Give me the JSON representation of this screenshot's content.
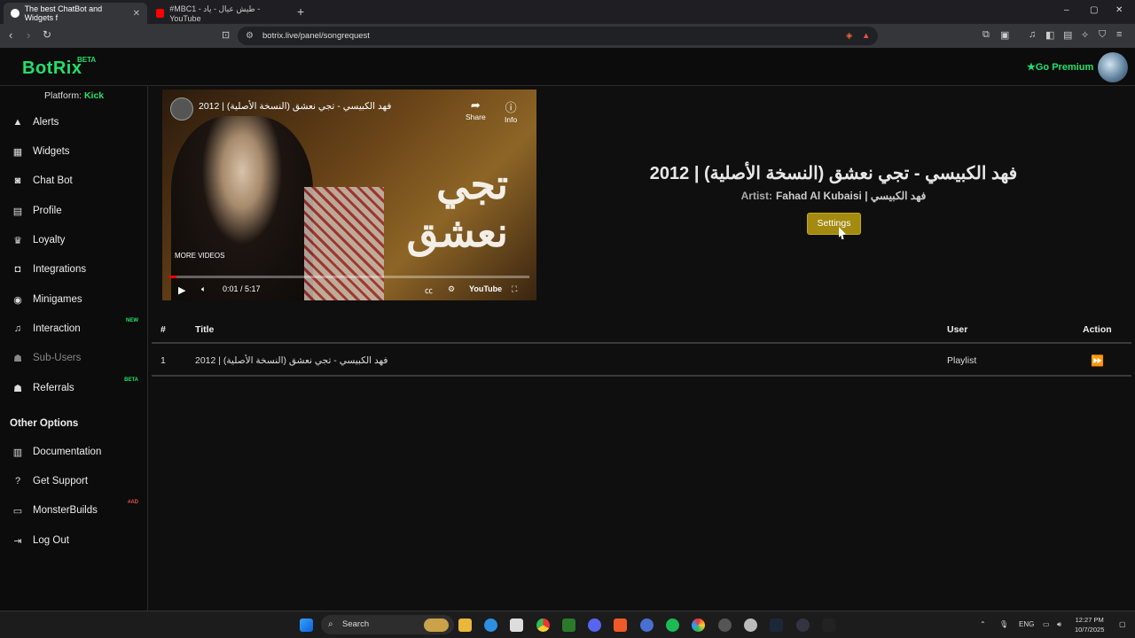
{
  "browser": {
    "tabs": [
      {
        "label": "The best ChatBot and Widgets f",
        "active": true
      },
      {
        "label": "#MBC1 - طيش عيال - ياد - YouTube",
        "active": false
      }
    ],
    "new_tab": "+",
    "window_controls": [
      "–",
      "▢",
      "✕"
    ],
    "url": "botrix.live/panel/songrequest"
  },
  "header": {
    "logo": "BotRix",
    "logo_badge": "BETA",
    "premium_label": "Go Premium"
  },
  "sidebar": {
    "platform_label": "Platform:",
    "platform_value": "Kick",
    "items": [
      {
        "label": "Alerts",
        "icon": "warning-icon"
      },
      {
        "label": "Widgets",
        "icon": "grid-icon"
      },
      {
        "label": "Chat Bot",
        "icon": "robot-icon"
      },
      {
        "label": "Profile",
        "icon": "id-card-icon"
      },
      {
        "label": "Loyalty",
        "icon": "trophy-icon"
      },
      {
        "label": "Integrations",
        "icon": "discord-icon"
      },
      {
        "label": "Minigames",
        "icon": "gamepad-icon"
      },
      {
        "label": "Interaction",
        "icon": "music-icon",
        "tag": "NEW"
      },
      {
        "label": "Sub-Users",
        "icon": "users-icon",
        "muted": true
      },
      {
        "label": "Referrals",
        "icon": "users-icon",
        "tag": "BETA"
      }
    ],
    "other_title": "Other Options",
    "other_items": [
      {
        "label": "Documentation",
        "icon": "book-icon"
      },
      {
        "label": "Get Support",
        "icon": "question-icon"
      },
      {
        "label": "MonsterBuilds",
        "icon": "laptop-icon",
        "tag": "#AD"
      },
      {
        "label": "Log Out",
        "icon": "logout-icon"
      }
    ]
  },
  "player": {
    "video_title": "فهد الكبيسي - تجي نعشق (النسخة الأصلية) | 2012",
    "share": "Share",
    "info": "Info",
    "overlay_text": "تجي نعشق",
    "more_videos": "MORE VIDEOS",
    "time": "0:01 / 5:17",
    "progress": 0.003,
    "youtube": "YouTube"
  },
  "now_playing": {
    "title": "فهد الكبيسي - تجي نعشق (النسخة الأصلية) | 2012",
    "artist_label": "Artist:",
    "artist": "Fahad Al Kubaisi | فهد الكبيسي",
    "settings_label": "Settings"
  },
  "queue": {
    "headers": [
      "#",
      "Title",
      "User",
      "Action"
    ],
    "rows": [
      {
        "num": "1",
        "title": "فهد الكبيسي - تجي نعشق (النسخة الأصلية) | 2012",
        "user": "Playlist",
        "action": "⏩"
      }
    ]
  },
  "taskbar": {
    "search_label": "Search",
    "lang": "ENG",
    "time": "12:27 PM",
    "date": "10/7/2025"
  }
}
